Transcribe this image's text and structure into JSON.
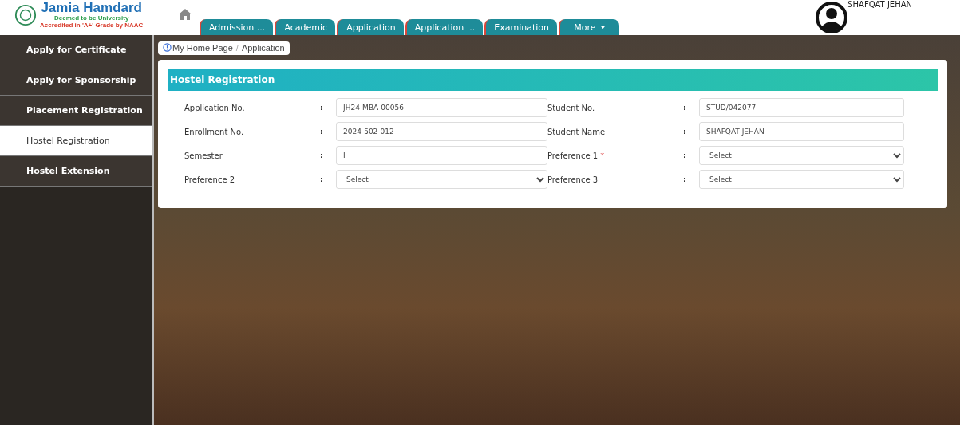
{
  "logo": {
    "name": "Jamia Hamdard",
    "subtitle": "Deemed to be University",
    "accreditation": "Accredited in 'A+' Grade by NAAC"
  },
  "tabs": [
    {
      "label": "Admission ...",
      "has_menu": false
    },
    {
      "label": "Academic",
      "has_menu": false
    },
    {
      "label": "Application",
      "has_menu": false
    },
    {
      "label": "Application ...",
      "has_menu": false
    },
    {
      "label": "Examination",
      "has_menu": false
    },
    {
      "label": "More",
      "has_menu": true
    }
  ],
  "user": {
    "name": "SHAFQAT JEHAN"
  },
  "sidebar": {
    "items": [
      {
        "label": "Apply for Certificate",
        "selected": false
      },
      {
        "label": "Apply for Sponsorship",
        "selected": false
      },
      {
        "label": "Placement Registration",
        "selected": false
      },
      {
        "label": "Hostel Registration",
        "selected": true
      },
      {
        "label": "Hostel Extension",
        "selected": false
      }
    ]
  },
  "breadcrumb": {
    "items": [
      "My Home Page",
      "Application"
    ],
    "separator": "/"
  },
  "form": {
    "title": "Hostel Registration",
    "fields": [
      {
        "label": "Application No.",
        "separator": ":",
        "kind": "input",
        "value": "JH24-MBA-00056"
      },
      {
        "label": "Student No.",
        "separator": ":",
        "kind": "input",
        "value": "STUD/042077"
      },
      {
        "label": "Enrollment No.",
        "separator": ":",
        "kind": "input",
        "value": "2024-502-012"
      },
      {
        "label": "Student Name",
        "separator": ":",
        "kind": "input",
        "value": "SHAFQAT JEHAN"
      },
      {
        "label": "Semester",
        "separator": ":",
        "kind": "input",
        "value": "I"
      },
      {
        "label": "Preference 1",
        "required_mark": "*",
        "separator": ":",
        "kind": "select",
        "value": "Select"
      },
      {
        "label": "Preference 2",
        "separator": ":",
        "kind": "select",
        "value": "Select"
      },
      {
        "label": "Preference 3",
        "separator": ":",
        "kind": "select",
        "value": "Select"
      }
    ]
  }
}
